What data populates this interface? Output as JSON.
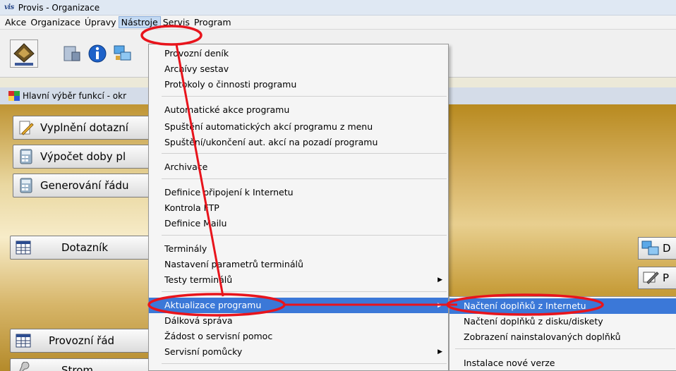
{
  "window": {
    "logo": "vis",
    "title": "Provis - Organizace"
  },
  "menubar": {
    "items": [
      "Akce",
      "Organizace",
      "Úpravy",
      "Nástroje",
      "Servis",
      "Program"
    ]
  },
  "panel": {
    "title": "Hlavní výběr funkcí - okr"
  },
  "side_buttons": {
    "vyplneni": "Vyplnění dotazní",
    "vypocet": "Výpočet doby pl",
    "generovani": "Generování řádu",
    "dotaznik": "Dotazník",
    "provozni_rad": "Provozní řád",
    "strom": "Strom"
  },
  "right_buttons": {
    "d": "D",
    "p": "P"
  },
  "dropdown": {
    "items": [
      "Provozní deník",
      "Archívy sestav",
      "Protokoly o činnosti programu",
      "Automatické akce programu",
      "Spuštění automatických akcí programu z menu",
      "Spuštění/ukončení aut. akcí na pozadí programu",
      "Archivace",
      "Definice připojení k Internetu",
      "Kontrola FTP",
      "Definice Mailu",
      "Terminály",
      "Nastavení parametrů terminálů",
      "Testy terminálů",
      "Aktualizace programu",
      "Dálková správa",
      "Žádost o servisní pomoc",
      "Servisní pomůcky"
    ]
  },
  "submenu": {
    "items": [
      "Načtení doplňků z Internetu",
      "Načtení doplňků z disku/diskety",
      "Zobrazení nainstalovaných doplňků",
      "Instalace nové verze"
    ]
  },
  "colors": {
    "highlight": "#3b78d8",
    "annotation": "#e8141c"
  }
}
